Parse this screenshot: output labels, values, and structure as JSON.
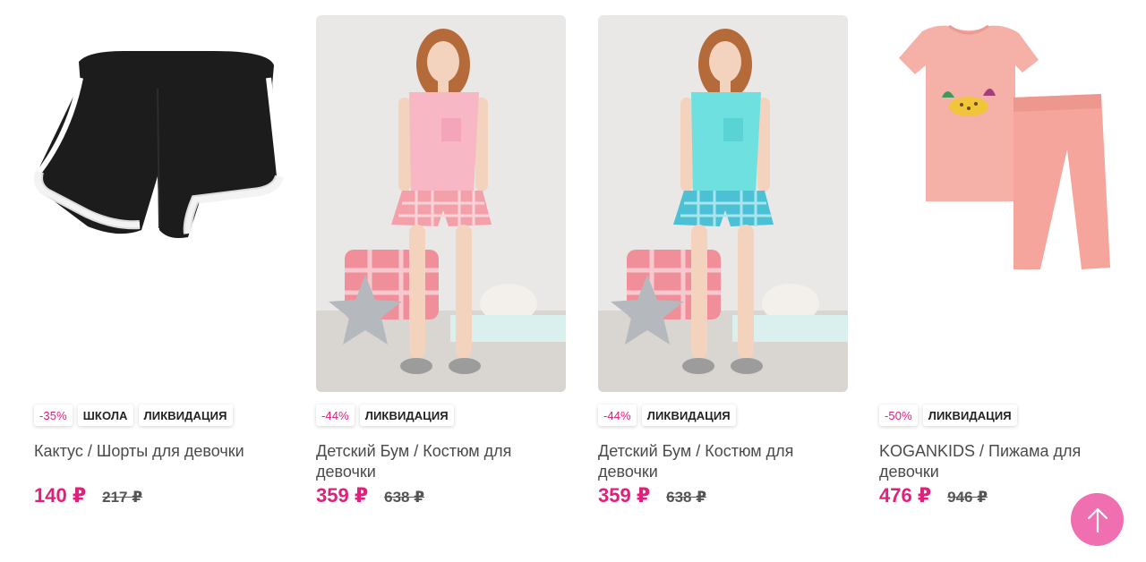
{
  "products": [
    {
      "image": "black-shorts",
      "badges": [
        "-35%",
        "ШКОЛА",
        "ЛИКВИДАЦИЯ"
      ],
      "title": "Кактус / Шорты для девочки",
      "price": "140 ₽",
      "old_price": "217 ₽"
    },
    {
      "image": "girl-pink-pajama",
      "badges": [
        "-44%",
        "ЛИКВИДАЦИЯ"
      ],
      "title": "Детский Бум / Костюм для девочки",
      "price": "359 ₽",
      "old_price": "638 ₽"
    },
    {
      "image": "girl-turquoise-pajama",
      "badges": [
        "-44%",
        "ЛИКВИДАЦИЯ"
      ],
      "title": "Детский Бум / Костюм для девочки",
      "price": "359 ₽",
      "old_price": "638 ₽"
    },
    {
      "image": "pink-pajama-leopard",
      "badges": [
        "-50%",
        "ЛИКВИДАЦИЯ"
      ],
      "title": "KOGANKIDS / Пижама для девочки",
      "price": "476 ₽",
      "old_price": "946 ₽"
    }
  ],
  "scroll_top": {
    "icon": "arrow-up-icon"
  },
  "colors": {
    "accent": "#e0207a",
    "scroll_button": "#f06fb0"
  }
}
